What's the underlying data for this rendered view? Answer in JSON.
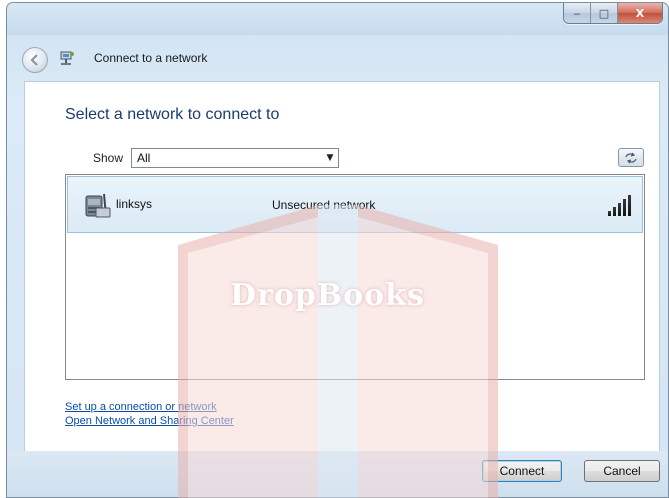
{
  "window": {
    "title": "Connect to a network",
    "caption_buttons": {
      "minimize": "‒",
      "maximize": "□",
      "close": "X"
    }
  },
  "main": {
    "heading": "Select a network to connect to",
    "show_label": "Show",
    "show_selected": "All",
    "refresh_icon": "refresh-icon"
  },
  "networks": [
    {
      "name": "linksys",
      "status": "Unsecured network",
      "icon": "router-icon",
      "signal_bars": 5
    }
  ],
  "links": {
    "setup": "Set up a connection or network",
    "open_center": "Open Network and Sharing Center"
  },
  "footer": {
    "connect_label": "Connect",
    "cancel_label": "Cancel"
  },
  "watermark": {
    "text": "DropBooks"
  },
  "colors": {
    "heading": "#1e3a6e",
    "link": "#0a4da8",
    "window_bg": "#d6e5f3",
    "selection": "#dbeaf5"
  }
}
